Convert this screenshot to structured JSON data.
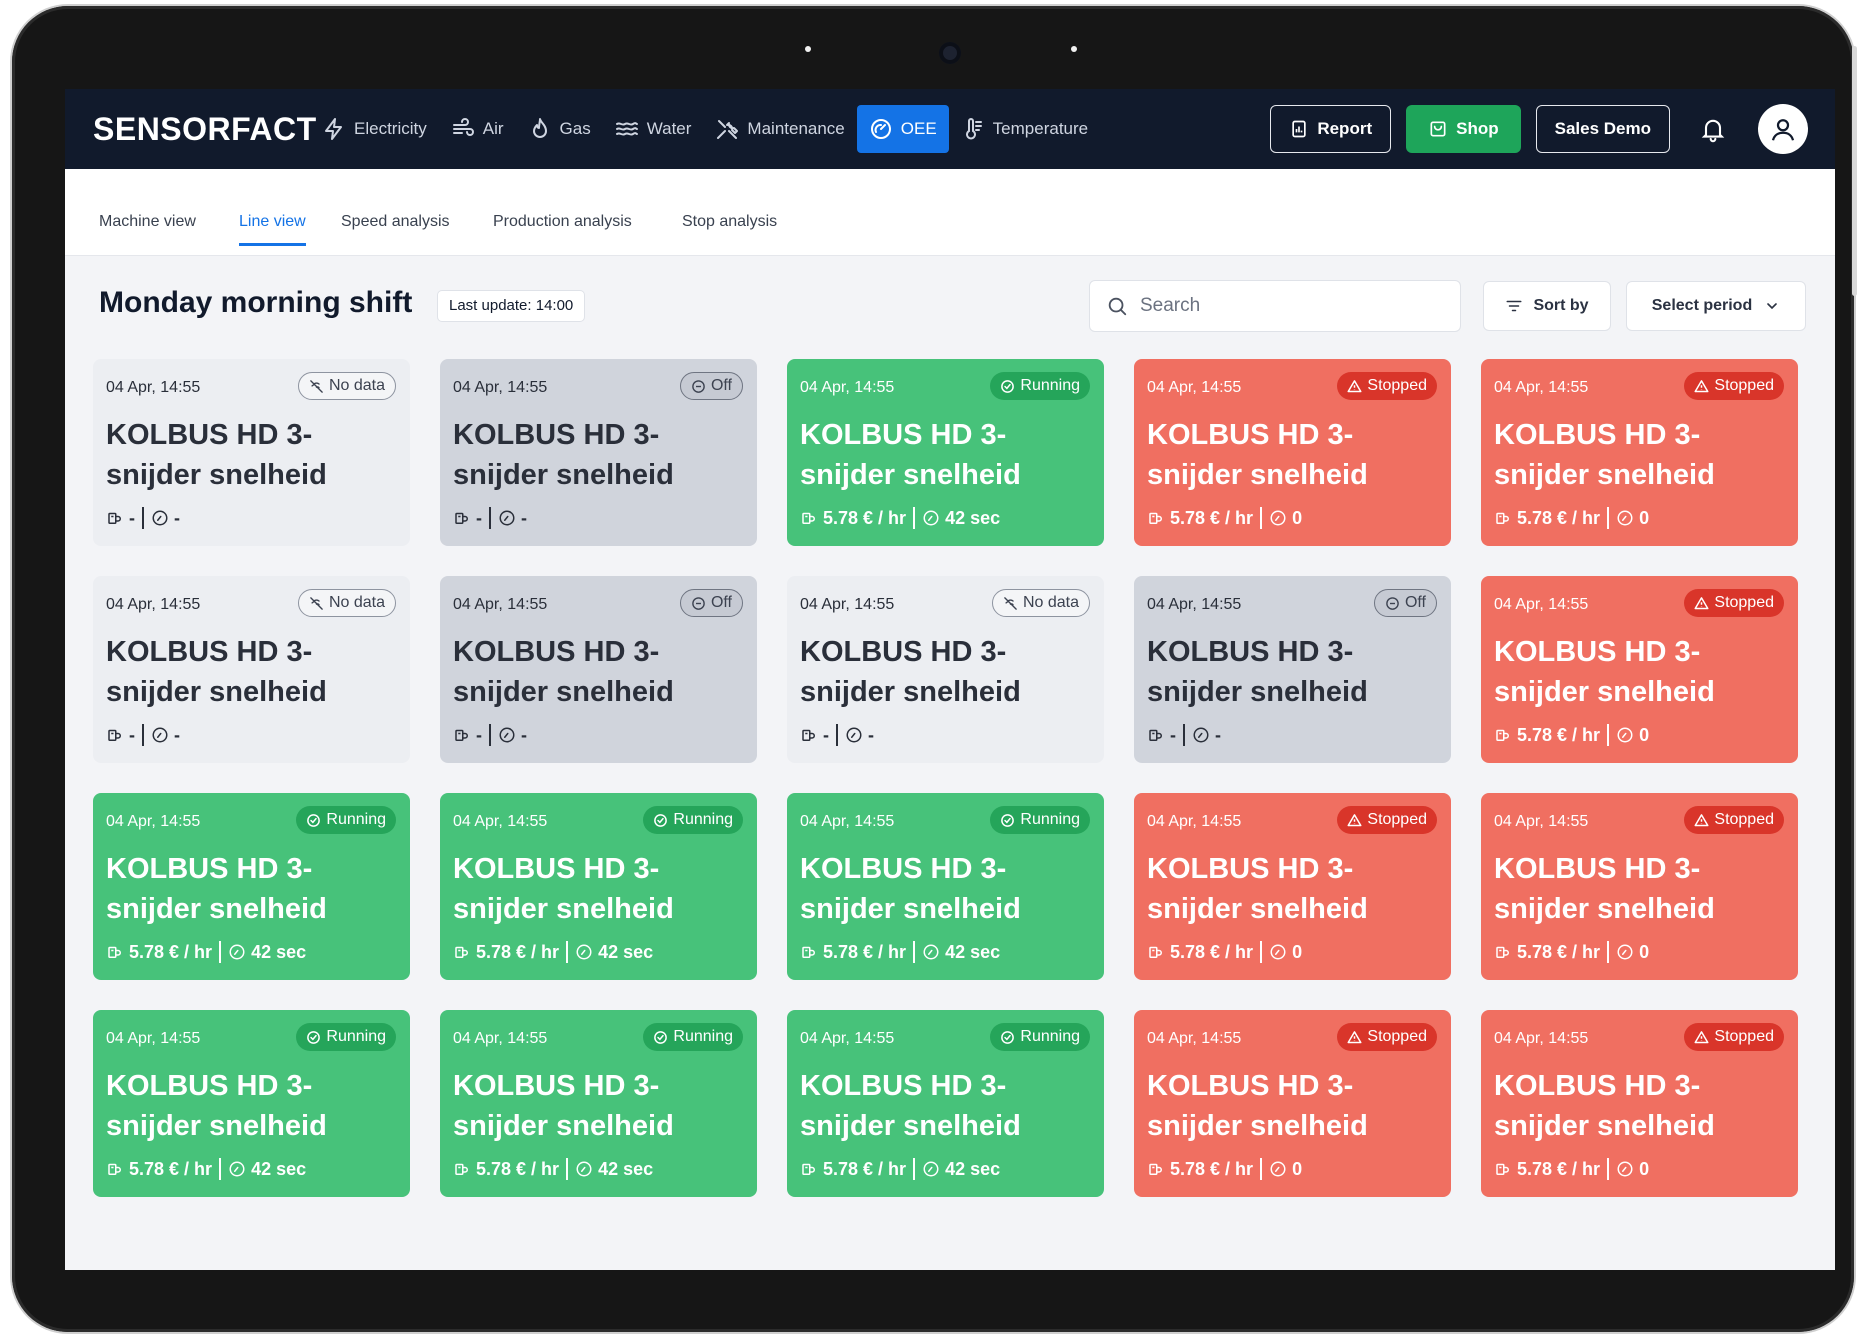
{
  "app": {
    "logo": "SENSORFACT"
  },
  "nav": {
    "items": [
      {
        "label": "Electricity",
        "icon": "bolt-icon"
      },
      {
        "label": "Air",
        "icon": "air-icon"
      },
      {
        "label": "Gas",
        "icon": "flame-icon"
      },
      {
        "label": "Water",
        "icon": "water-icon"
      },
      {
        "label": "Maintenance",
        "icon": "wrench-icon"
      },
      {
        "label": "OEE",
        "icon": "gauge-icon",
        "active": true
      },
      {
        "label": "Temperature",
        "icon": "thermometer-icon"
      }
    ],
    "report_label": "Report",
    "shop_label": "Shop",
    "account_label": "Sales Demo"
  },
  "tabs": [
    {
      "label": "Machine view"
    },
    {
      "label": "Line view",
      "active": true
    },
    {
      "label": "Speed analysis"
    },
    {
      "label": "Production analysis"
    },
    {
      "label": "Stop analysis"
    }
  ],
  "header": {
    "title": "Monday morning shift",
    "last_update": "Last update: 14:00",
    "search_placeholder": "Search",
    "sort_label": "Sort by",
    "period_label": "Select period"
  },
  "colors": {
    "nav_bg": "#111a2c",
    "accent": "#1473e6",
    "running": "#47c27a",
    "stopped": "#f06f61",
    "off": "#d0d4dc",
    "no_data": "#eceef2"
  },
  "cards": [
    {
      "status": "nodata",
      "badge": "No data",
      "time": "04 Apr, 14:55",
      "title": "KOLBUS HD 3-snijder snelheid",
      "cost": "-",
      "duration": "-"
    },
    {
      "status": "off",
      "badge": "Off",
      "time": "04 Apr, 14:55",
      "title": "KOLBUS HD 3-snijder snelheid",
      "cost": "-",
      "duration": "-"
    },
    {
      "status": "running",
      "badge": "Running",
      "time": "04 Apr, 14:55",
      "title": "KOLBUS HD 3-snijder snelheid",
      "cost": "5.78 € / hr",
      "duration": "42 sec"
    },
    {
      "status": "stopped",
      "badge": "Stopped",
      "time": "04 Apr, 14:55",
      "title": "KOLBUS HD 3-snijder snelheid",
      "cost": "5.78 € / hr",
      "duration": "0"
    },
    {
      "status": "stopped",
      "badge": "Stopped",
      "time": "04 Apr, 14:55",
      "title": "KOLBUS HD 3-snijder snelheid",
      "cost": "5.78 € / hr",
      "duration": "0"
    },
    {
      "status": "nodata",
      "badge": "No data",
      "time": "04 Apr, 14:55",
      "title": "KOLBUS HD 3-snijder snelheid",
      "cost": "-",
      "duration": "-"
    },
    {
      "status": "off",
      "badge": "Off",
      "time": "04 Apr, 14:55",
      "title": "KOLBUS HD 3-snijder snelheid",
      "cost": "-",
      "duration": "-"
    },
    {
      "status": "nodata",
      "badge": "No data",
      "time": "04 Apr, 14:55",
      "title": "KOLBUS HD 3-snijder snelheid",
      "cost": "-",
      "duration": "-"
    },
    {
      "status": "off",
      "badge": "Off",
      "time": "04 Apr, 14:55",
      "title": "KOLBUS HD 3-snijder snelheid",
      "cost": "-",
      "duration": "-"
    },
    {
      "status": "stopped",
      "badge": "Stopped",
      "time": "04 Apr, 14:55",
      "title": "KOLBUS HD 3-snijder snelheid",
      "cost": "5.78 € / hr",
      "duration": "0"
    },
    {
      "status": "running",
      "badge": "Running",
      "time": "04 Apr, 14:55",
      "title": "KOLBUS HD 3-snijder snelheid",
      "cost": "5.78 € / hr",
      "duration": "42 sec"
    },
    {
      "status": "running",
      "badge": "Running",
      "time": "04 Apr, 14:55",
      "title": "KOLBUS HD 3-snijder snelheid",
      "cost": "5.78 € / hr",
      "duration": "42 sec"
    },
    {
      "status": "running",
      "badge": "Running",
      "time": "04 Apr, 14:55",
      "title": "KOLBUS HD 3-snijder snelheid",
      "cost": "5.78 € / hr",
      "duration": "42 sec"
    },
    {
      "status": "stopped",
      "badge": "Stopped",
      "time": "04 Apr, 14:55",
      "title": "KOLBUS HD 3-snijder snelheid",
      "cost": "5.78 € / hr",
      "duration": "0"
    },
    {
      "status": "stopped",
      "badge": "Stopped",
      "time": "04 Apr, 14:55",
      "title": "KOLBUS HD 3-snijder snelheid",
      "cost": "5.78 € / hr",
      "duration": "0"
    },
    {
      "status": "running",
      "badge": "Running",
      "time": "04 Apr, 14:55",
      "title": "KOLBUS HD 3-snijder snelheid",
      "cost": "5.78 € / hr",
      "duration": "42 sec"
    },
    {
      "status": "running",
      "badge": "Running",
      "time": "04 Apr, 14:55",
      "title": "KOLBUS HD 3-snijder snelheid",
      "cost": "5.78 € / hr",
      "duration": "42 sec"
    },
    {
      "status": "running",
      "badge": "Running",
      "time": "04 Apr, 14:55",
      "title": "KOLBUS HD 3-snijder snelheid",
      "cost": "5.78 € / hr",
      "duration": "42 sec"
    },
    {
      "status": "stopped",
      "badge": "Stopped",
      "time": "04 Apr, 14:55",
      "title": "KOLBUS HD 3-snijder snelheid",
      "cost": "5.78 € / hr",
      "duration": "0"
    },
    {
      "status": "stopped",
      "badge": "Stopped",
      "time": "04 Apr, 14:55",
      "title": "KOLBUS HD 3-snijder snelheid",
      "cost": "5.78 € / hr",
      "duration": "0"
    }
  ]
}
